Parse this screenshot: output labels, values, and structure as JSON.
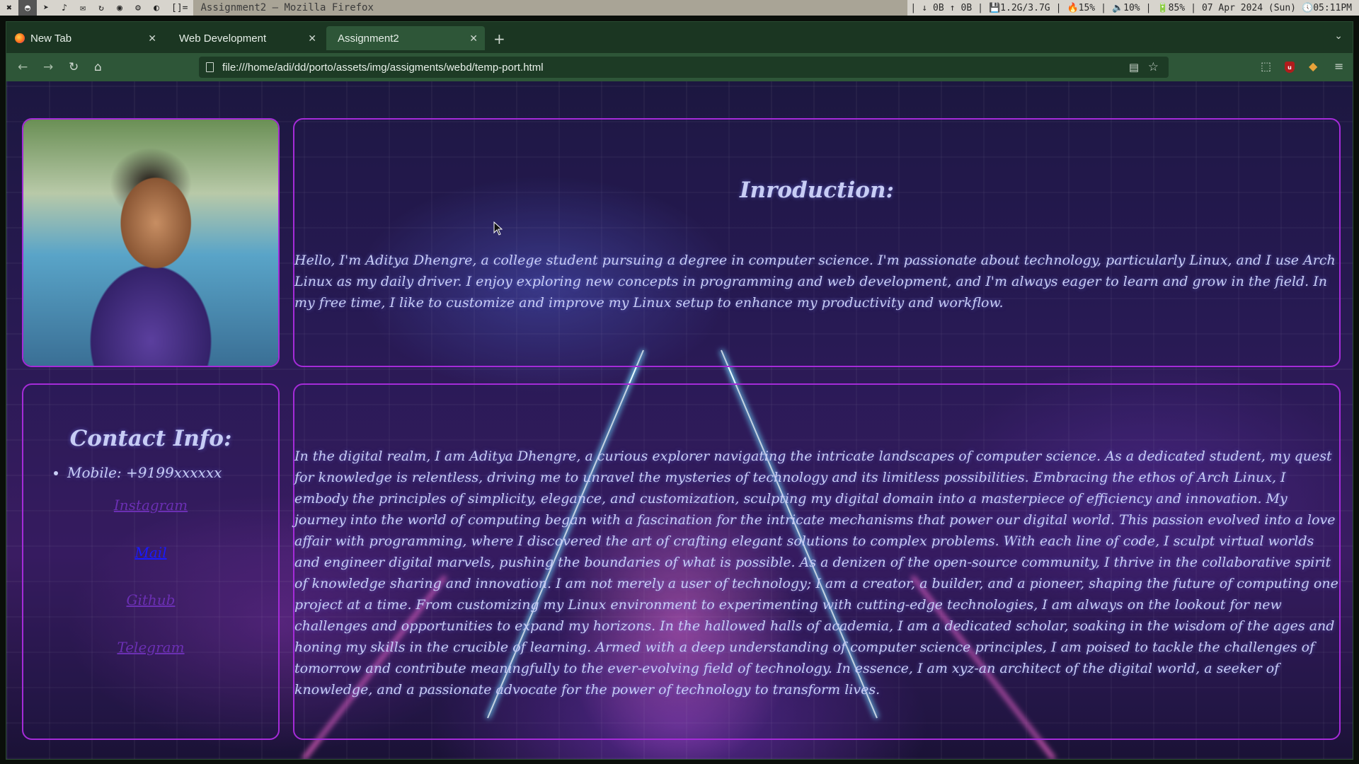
{
  "wm": {
    "layout_indicator": "[]=",
    "window_title": "Assignment2 — Mozilla Firefox",
    "status": {
      "down_arrow": "↓",
      "down_rate": "0B",
      "up_arrow": "↑",
      "up_rate": "0B",
      "memory": "💾1.2G/3.7G",
      "cpu": "🔥15%",
      "volume": "🔈10%",
      "battery": "🔋85%",
      "date": "07 Apr 2024 (Sun)",
      "time": "🕔05:11PM"
    }
  },
  "browser": {
    "tabs": [
      {
        "label": "New Tab"
      },
      {
        "label": "Web Development"
      },
      {
        "label": "Assignment2"
      }
    ],
    "url": "file:///home/adi/dd/porto/assets/img/assigments/webd/temp-port.html"
  },
  "page": {
    "intro_heading": "Inroduction:",
    "intro_text": "Hello, I'm Aditya Dhengre, a college student pursuing a degree in computer science. I'm passionate about technology, particularly Linux, and I use Arch Linux as my daily driver. I enjoy exploring new concepts in programming and web development, and I'm always eager to learn and grow in the field. In my free time, I like to customize and improve my Linux setup to enhance my productivity and workflow.",
    "contact_heading": "Contact Info:",
    "mobile": "Mobile: +9199xxxxxx",
    "links": [
      "Instagram",
      "Mail",
      "Github",
      "Telegram"
    ],
    "bio_text": "In the digital realm, I am Aditya Dhengre, a curious explorer navigating the intricate landscapes of computer science. As a dedicated student, my quest for knowledge is relentless, driving me to unravel the mysteries of technology and its limitless possibilities. Embracing the ethos of Arch Linux, I embody the principles of simplicity, elegance, and customization, sculpting my digital domain into a masterpiece of efficiency and innovation. My journey into the world of computing began with a fascination for the intricate mechanisms that power our digital world. This passion evolved into a love affair with programming, where I discovered the art of crafting elegant solutions to complex problems. With each line of code, I sculpt virtual worlds and engineer digital marvels, pushing the boundaries of what is possible. As a denizen of the open-source community, I thrive in the collaborative spirit of knowledge sharing and innovation. I am not merely a user of technology; I am a creator, a builder, and a pioneer, shaping the future of computing one project at a time. From customizing my Linux environment to experimenting with cutting-edge technologies, I am always on the lookout for new challenges and opportunities to expand my horizons. In the hallowed halls of academia, I am a dedicated scholar, soaking in the wisdom of the ages and honing my skills in the crucible of learning. Armed with a deep understanding of computer science principles, I am poised to tackle the challenges of tomorrow and contribute meaningfully to the ever-evolving field of technology. In essence, I am xyz-an architect of the digital world, a seeker of knowledge, and a passionate advocate for the power of technology to transform lives."
  },
  "colors": {
    "card_border": "#a52bd8",
    "heading_text": "#c8cdf5",
    "link_visited": "#6b2fb3",
    "link_unvisited": "#1a1aff",
    "browser_chrome": "#2e5638"
  }
}
